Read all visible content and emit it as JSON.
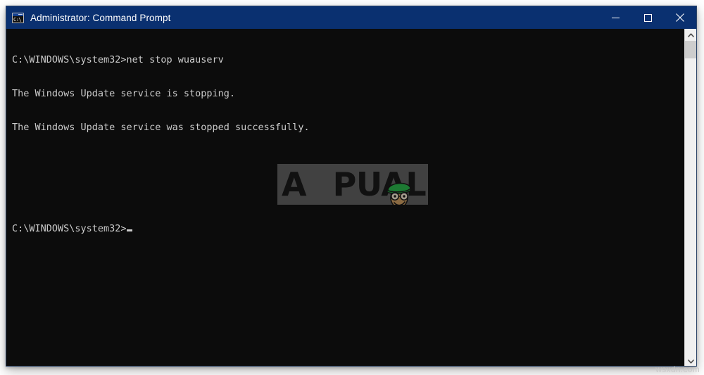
{
  "window": {
    "title": "Administrator: Command Prompt",
    "icon": "command-prompt-icon",
    "icon_glyph": "C:\\",
    "titlebar_color": "#0a3070",
    "background_color": "#0c0c0c",
    "text_color": "#cccccc"
  },
  "controls": {
    "minimize_label": "Minimize",
    "maximize_label": "Maximize",
    "close_label": "Close"
  },
  "console": {
    "lines": [
      "C:\\WINDOWS\\system32>net stop wuauserv",
      "The Windows Update service is stopping.",
      "The Windows Update service was stopped successfully.",
      "",
      "",
      "C:\\WINDOWS\\system32>"
    ],
    "prompt": "C:\\WINDOWS\\system32>",
    "command": "net stop wuauserv",
    "cursor_visible": true
  },
  "scrollbar": {
    "up_arrow": "chevron-up-icon",
    "down_arrow": "chevron-down-icon",
    "thumb_position_percent": 0,
    "thumb_size_percent": 6
  },
  "watermark": {
    "brand_first_letter": "A",
    "brand_rest": "PUALS",
    "mascot": "appuals-mascot-green-cap"
  },
  "page_watermark": {
    "text": "wsxdn.com"
  }
}
